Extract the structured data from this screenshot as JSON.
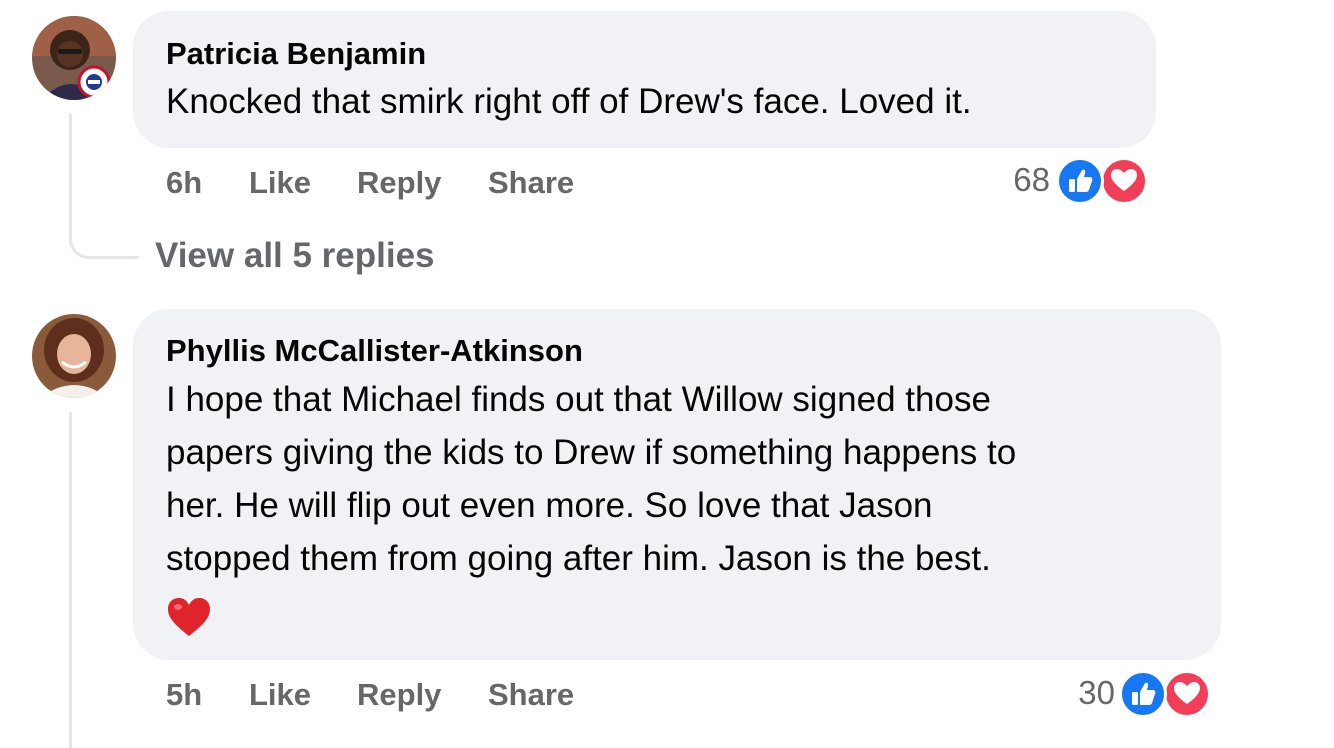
{
  "comments": [
    {
      "author": "Patricia Benjamin",
      "lines": [
        "Knocked that smirk right off of Drew's face. Loved it."
      ],
      "time": "6h",
      "like_label": "Like",
      "reply_label": "Reply",
      "share_label": "Share",
      "reaction_count": "68",
      "reaction_icons": [
        "like-icon",
        "love-icon"
      ],
      "view_replies_label": "View all 5 replies"
    },
    {
      "author": "Phyllis McCallister-Atkinson",
      "lines": [
        "I hope that Michael finds out that Willow signed those",
        "papers giving the kids to Drew if something happens to",
        "her. He will flip out even more. So love that Jason",
        "stopped them from going after him. Jason is the best."
      ],
      "emoji": "red-heart-icon",
      "time": "5h",
      "like_label": "Like",
      "reply_label": "Reply",
      "share_label": "Share",
      "reaction_count": "30",
      "reaction_icons": [
        "like-icon",
        "love-icon"
      ]
    }
  ],
  "colors": {
    "bubble": "#f0f2f5",
    "secondary_text": "#65676b",
    "like_blue": "#1877f2",
    "love_red": "#f33e58",
    "thread_line": "#e4e6eb"
  }
}
